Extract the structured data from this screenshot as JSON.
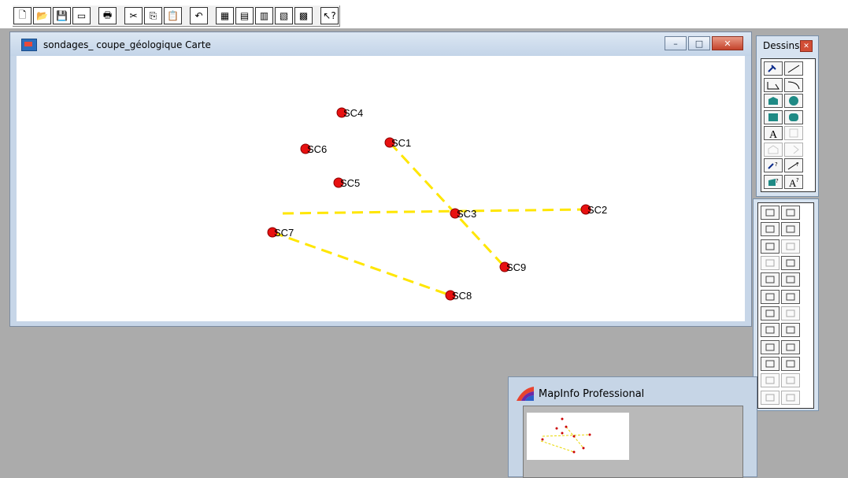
{
  "toolbar": {
    "buttons": [
      {
        "name": "new-document-button",
        "glyph": "🗋"
      },
      {
        "name": "open-button",
        "glyph": "📂"
      },
      {
        "name": "save-button",
        "glyph": "💾"
      },
      {
        "name": "window-button",
        "glyph": "▭"
      },
      {
        "name": "print-button",
        "glyph": "🖶"
      },
      {
        "name": "cut-button",
        "glyph": "✂"
      },
      {
        "name": "copy-button",
        "glyph": "⎘"
      },
      {
        "name": "paste-button",
        "glyph": "📋"
      },
      {
        "name": "undo-button",
        "glyph": "↶"
      },
      {
        "name": "browser-button",
        "glyph": "▦"
      },
      {
        "name": "map-button",
        "glyph": "▤"
      },
      {
        "name": "graph-button",
        "glyph": "▥"
      },
      {
        "name": "layout-button",
        "glyph": "▧"
      },
      {
        "name": "redistrict-button",
        "glyph": "▩"
      },
      {
        "name": "help-button",
        "glyph": "↖?"
      }
    ]
  },
  "map_window": {
    "title": "sondages_ coupe_géologique Carte",
    "controls": {
      "minimize": "–",
      "maximize": "□",
      "close": "✕"
    },
    "accent": "#ffe600",
    "point_color": "#e81010",
    "points": [
      {
        "label": "SC4"
      },
      {
        "label": "SC1"
      },
      {
        "label": "SC6"
      },
      {
        "label": "SC5"
      },
      {
        "label": "SC3"
      },
      {
        "label": "SC2"
      },
      {
        "label": "SC7"
      },
      {
        "label": "SC9"
      },
      {
        "label": "SC8"
      }
    ]
  },
  "drawing_palette": {
    "title": "Dessins",
    "tools": [
      "symbol-tool",
      "line-tool",
      "polyline-tool",
      "arc-tool",
      "polygon-tool",
      "ellipse-tool",
      "rectangle-tool",
      "rounded-rect-tool",
      "text-tool",
      "frame-tool",
      "reshape-tool",
      "add-node-tool",
      "symbol-style",
      "line-style",
      "region-style",
      "text-style"
    ]
  },
  "main_palette": {
    "tools": [
      "select-tool",
      "marquee-select-tool",
      "radius-select-tool",
      "polygon-select-tool",
      "boundary-select-tool",
      "unselect-all-tool",
      "invert-selection-tool",
      "graph-select-tool",
      "zoom-in-tool",
      "zoom-out-tool",
      "change-view-tool",
      "grabber-tool",
      "info-tool",
      "hotlink-tool",
      "label-tool",
      "drag-window-tool",
      "layer-control-tool",
      "ruler-tool",
      "legend-tool",
      "statistics-tool",
      "clip-region-tool",
      "set-target-tool",
      "distance-tool",
      "region-tool"
    ]
  },
  "thumbnail": {
    "title": "MapInfo Professional"
  }
}
